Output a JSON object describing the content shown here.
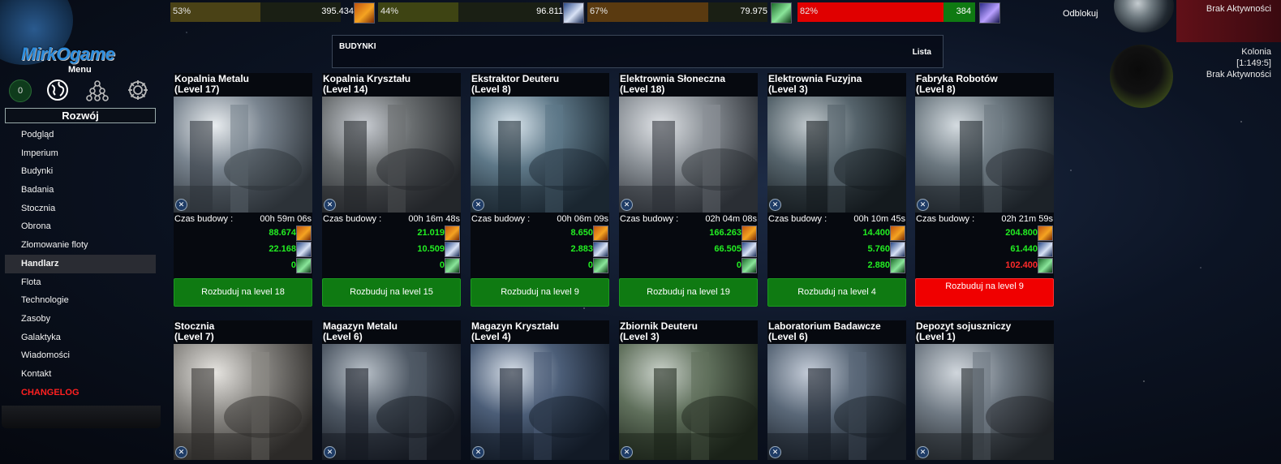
{
  "resources": [
    {
      "name": "metal",
      "percent": "53%",
      "fill_fraction": 0.53,
      "amount": "395.434",
      "fill_color": "#4a4216",
      "icon": "metal-icon"
    },
    {
      "name": "crystal",
      "percent": "44%",
      "fill_fraction": 0.44,
      "amount": "96.811",
      "fill_color": "#3e4413",
      "icon": "crystal-icon"
    },
    {
      "name": "deuterium",
      "percent": "67%",
      "fill_fraction": 0.67,
      "amount": "79.975",
      "fill_color": "#5a3a10",
      "icon": "deuterium-icon"
    },
    {
      "name": "energy",
      "percent": "82%",
      "fill_fraction": 0.82,
      "amount": "384",
      "fill_color": "#e00000",
      "icon": "energy-icon"
    }
  ],
  "unlock_label": "Odblokuj",
  "sidebar": {
    "logo": "MirkOgame",
    "menu_title": "Menu",
    "counter": "0",
    "section": "Rozwój",
    "items": [
      {
        "label": "Podgląd"
      },
      {
        "label": "Imperium"
      },
      {
        "label": "Budynki"
      },
      {
        "label": "Badania"
      },
      {
        "label": "Stocznia"
      },
      {
        "label": "Obrona"
      },
      {
        "label": "Złomowanie floty"
      },
      {
        "label": "Handlarz",
        "active": true
      },
      {
        "label": "Flota"
      },
      {
        "label": "Technologie"
      },
      {
        "label": "Zasoby"
      },
      {
        "label": "Galaktyka"
      },
      {
        "label": "Wiadomości"
      },
      {
        "label": "Kontakt"
      },
      {
        "label": "CHANGELOG",
        "red": true
      }
    ]
  },
  "header": {
    "title": "BUDYNKI",
    "list_link": "Lista"
  },
  "build_time_label": "Czas budowy :",
  "buildings_row1": [
    {
      "name": "Kopalnia Metalu",
      "level": "(Level 17)",
      "time": "00h 59m 06s",
      "metal": "88.674",
      "crystal": "22.168",
      "deut": "0",
      "button": "Rozbuduj na level 18",
      "affordable": true
    },
    {
      "name": "Kopalnia Kryształu",
      "level": "(Level 14)",
      "time": "00h 16m 48s",
      "metal": "21.019",
      "crystal": "10.509",
      "deut": "0",
      "button": "Rozbuduj na level 15",
      "affordable": true
    },
    {
      "name": "Ekstraktor Deuteru",
      "level": "(Level 8)",
      "time": "00h 06m 09s",
      "metal": "8.650",
      "crystal": "2.883",
      "deut": "0",
      "button": "Rozbuduj na level 9",
      "affordable": true
    },
    {
      "name": "Elektrownia Słoneczna",
      "level": "(Level 18)",
      "time": "02h 04m 08s",
      "metal": "166.263",
      "crystal": "66.505",
      "deut": "0",
      "button": "Rozbuduj na level 19",
      "affordable": true
    },
    {
      "name": "Elektrownia Fuzyjna",
      "level": "(Level 3)",
      "time": "00h 10m 45s",
      "metal": "14.400",
      "crystal": "5.760",
      "deut": "2.880",
      "button": "Rozbuduj na level 4",
      "affordable": true
    },
    {
      "name": "Fabryka Robotów",
      "level": "(Level 8)",
      "time": "02h 21m 59s",
      "metal": "204.800",
      "crystal": "61.440",
      "deut": "102.400",
      "deut_short": true,
      "button": "Rozbuduj na level 9",
      "affordable": false
    }
  ],
  "buildings_row2": [
    {
      "name": "Stocznia",
      "level": "(Level 7)"
    },
    {
      "name": "Magazyn Metalu",
      "level": "(Level 6)"
    },
    {
      "name": "Magazyn Kryształu",
      "level": "(Level 4)"
    },
    {
      "name": "Zbiornik Deuteru",
      "level": "(Level 3)"
    },
    {
      "name": "Laboratorium Badawcze",
      "level": "(Level 6)"
    },
    {
      "name": "Depozyt sojuszniczy",
      "level": "(Level 1)"
    }
  ],
  "planets": {
    "top_status": "Brak Aktywności",
    "colony_name": "Kolonia",
    "colony_coords": "[1:149:5]",
    "colony_status": "Brak Aktywności"
  }
}
